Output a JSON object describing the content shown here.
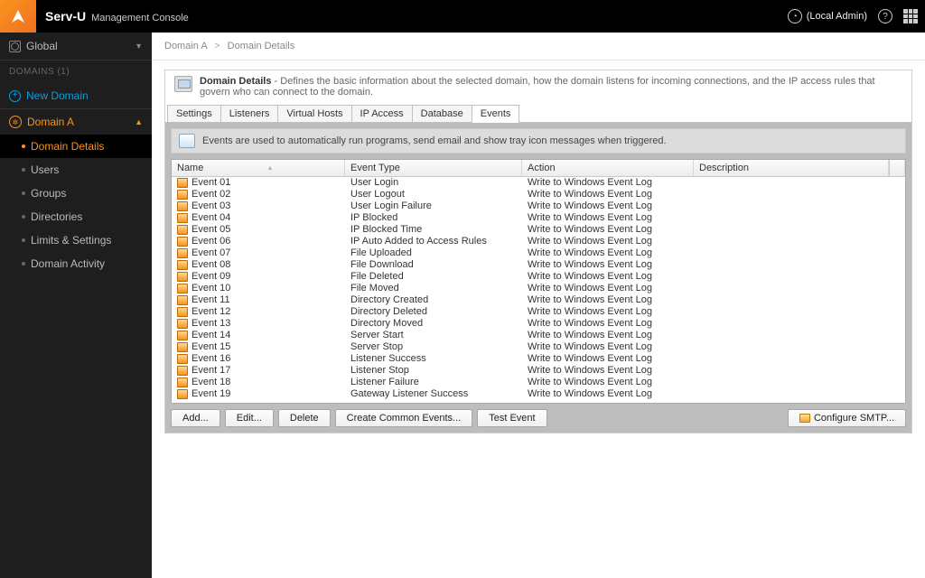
{
  "topbar": {
    "brand": "Serv-U",
    "subtitle": "Management Console",
    "user_label": "(Local Admin)"
  },
  "sidebar": {
    "global_label": "Global",
    "domains_header": "DOMAINS (1)",
    "new_domain": "New Domain",
    "domain_name": "Domain A",
    "children": [
      {
        "label": "Domain Details",
        "active": true
      },
      {
        "label": "Users",
        "active": false
      },
      {
        "label": "Groups",
        "active": false
      },
      {
        "label": "Directories",
        "active": false
      },
      {
        "label": "Limits & Settings",
        "active": false
      },
      {
        "label": "Domain Activity",
        "active": false
      }
    ]
  },
  "breadcrumb": {
    "a": "Domain A",
    "b": "Domain Details"
  },
  "desc": {
    "title": "Domain Details",
    "text": "Defines the basic information about the selected domain, how the domain listens for incoming connections, and the IP access rules that govern who can connect to the domain."
  },
  "tabs": [
    {
      "label": "Settings"
    },
    {
      "label": "Listeners"
    },
    {
      "label": "Virtual Hosts"
    },
    {
      "label": "IP Access"
    },
    {
      "label": "Database"
    },
    {
      "label": "Events",
      "active": true
    }
  ],
  "info_text": "Events are used to automatically run programs, send email and show tray icon messages when triggered.",
  "columns": {
    "name": "Name",
    "type": "Event Type",
    "action": "Action",
    "desc": "Description"
  },
  "rows": [
    {
      "name": "Event 01",
      "type": "User Login",
      "action": "Write to Windows Event Log"
    },
    {
      "name": "Event 02",
      "type": "User Logout",
      "action": "Write to Windows Event Log"
    },
    {
      "name": "Event 03",
      "type": "User Login Failure",
      "action": "Write to Windows Event Log"
    },
    {
      "name": "Event 04",
      "type": "IP Blocked",
      "action": "Write to Windows Event Log"
    },
    {
      "name": "Event 05",
      "type": "IP Blocked Time",
      "action": "Write to Windows Event Log"
    },
    {
      "name": "Event 06",
      "type": "IP Auto Added to Access Rules",
      "action": "Write to Windows Event Log"
    },
    {
      "name": "Event 07",
      "type": "File Uploaded",
      "action": "Write to Windows Event Log"
    },
    {
      "name": "Event 08",
      "type": "File Download",
      "action": "Write to Windows Event Log"
    },
    {
      "name": "Event 09",
      "type": "File Deleted",
      "action": "Write to Windows Event Log"
    },
    {
      "name": "Event 10",
      "type": "File Moved",
      "action": "Write to Windows Event Log"
    },
    {
      "name": "Event 11",
      "type": "Directory Created",
      "action": "Write to Windows Event Log"
    },
    {
      "name": "Event 12",
      "type": "Directory Deleted",
      "action": "Write to Windows Event Log"
    },
    {
      "name": "Event 13",
      "type": "Directory Moved",
      "action": "Write to Windows Event Log"
    },
    {
      "name": "Event 14",
      "type": "Server Start",
      "action": "Write to Windows Event Log"
    },
    {
      "name": "Event 15",
      "type": "Server Stop",
      "action": "Write to Windows Event Log"
    },
    {
      "name": "Event 16",
      "type": "Listener Success",
      "action": "Write to Windows Event Log"
    },
    {
      "name": "Event 17",
      "type": "Listener Stop",
      "action": "Write to Windows Event Log"
    },
    {
      "name": "Event 18",
      "type": "Listener Failure",
      "action": "Write to Windows Event Log"
    },
    {
      "name": "Event 19",
      "type": "Gateway Listener Success",
      "action": "Write to Windows Event Log"
    }
  ],
  "buttons": {
    "add": "Add...",
    "edit": "Edit...",
    "delete": "Delete",
    "create_common": "Create Common Events...",
    "test": "Test Event",
    "smtp": "Configure SMTP..."
  }
}
